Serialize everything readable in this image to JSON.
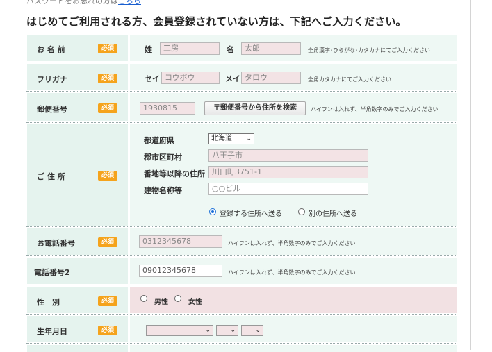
{
  "top_note": {
    "text": "パスワードをお忘れの方は",
    "link": "こちら"
  },
  "heading": "はじめてご利用される方、会員登録されていない方は、下記へご入力ください。",
  "required_badge": "必須",
  "name_row": {
    "label": "お 名 前",
    "last_label": "姓",
    "last_value": "工房",
    "first_label": "名",
    "first_value": "太郎",
    "note": "全角漢字･ひらがな･カタカナにてご入力ください"
  },
  "kana_row": {
    "label": "フリガナ",
    "last_label": "セイ",
    "last_value": "コウボウ",
    "first_label": "メイ",
    "first_value": "タロウ",
    "note": "全角カタカナにてご入力ください"
  },
  "postal_row": {
    "label": "郵便番号",
    "value": "1930815",
    "button": "〒郵便番号から住所を検索",
    "note": "ハイフンは入れず、半角数字のみでご入力ください"
  },
  "address_row": {
    "label": "ご 住 所",
    "prefecture_label": "都道府県",
    "prefecture_value": "北海道",
    "city_label": "郡市区町村",
    "city_value": "八王子市",
    "street_label": "番地等以降の住所",
    "street_value": "川口町3751-1",
    "building_label": "建物名称等",
    "building_placeholder": "○○ビル",
    "radio_same": "登録する住所へ送る",
    "radio_other": "別の住所へ送る"
  },
  "phone_row": {
    "label": "お電話番号",
    "value": "0312345678",
    "note": "ハイフンは入れず、半角数字のみでご入力ください"
  },
  "phone2_row": {
    "label": "電話番号2",
    "value": "09012345678",
    "note": "ハイフンは入れず、半角数字のみでご入力ください"
  },
  "gender_row": {
    "label": "性　別",
    "male": "男性",
    "female": "女性"
  },
  "birth_row": {
    "label": "生年月日"
  }
}
